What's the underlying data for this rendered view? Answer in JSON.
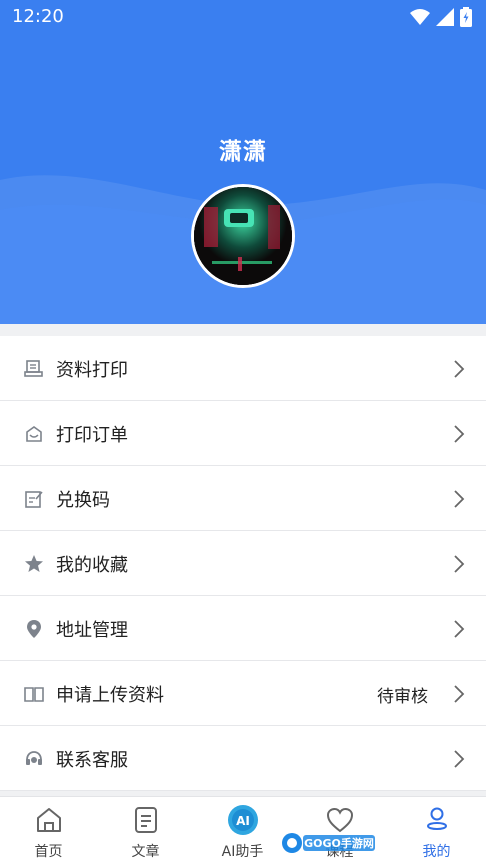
{
  "status_bar": {
    "time": "12:20"
  },
  "profile": {
    "username": "潇潇"
  },
  "menu": [
    {
      "label": "资料打印",
      "icon": "printer-icon"
    },
    {
      "label": "打印订单",
      "icon": "order-icon"
    },
    {
      "label": "兑换码",
      "icon": "edit-icon"
    },
    {
      "label": "我的收藏",
      "icon": "star-icon"
    },
    {
      "label": "地址管理",
      "icon": "location-icon"
    },
    {
      "label": "申请上传资料",
      "icon": "book-icon",
      "status": "待审核"
    },
    {
      "label": "联系客服",
      "icon": "headset-icon"
    }
  ],
  "tabs": [
    {
      "label": "首页",
      "icon": "home-icon"
    },
    {
      "label": "文章",
      "icon": "document-icon"
    },
    {
      "label": "AI助手",
      "icon": "ai-icon"
    },
    {
      "label": "课程",
      "icon": "heart-icon"
    },
    {
      "label": "我的",
      "icon": "user-icon",
      "active": true
    }
  ],
  "watermark": {
    "text": "GOGO手游网"
  },
  "colors": {
    "header_blue": "#3a7ff0",
    "active_blue": "#2f6fe6",
    "icon_gray": "#7d838c"
  }
}
